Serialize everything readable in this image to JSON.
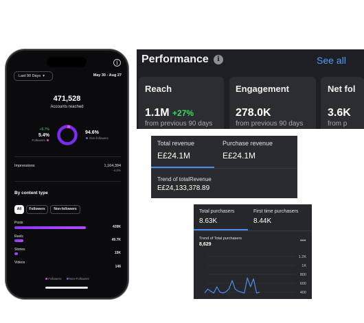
{
  "phone": {
    "info_icon": "i",
    "date_pill": "Last 90 Days",
    "date_range": "May 30 - Aug 27",
    "accounts_reached_value": "471,528",
    "accounts_reached_label": "Accounts reached",
    "followers": {
      "change": "+6.7%",
      "percent": "5.4%",
      "label": "Followers",
      "fraction": 0.054
    },
    "non_followers": {
      "percent": "94.6%",
      "label": "Non-followers",
      "fraction": 0.946
    },
    "impressions": {
      "label": "Impressions",
      "value": "1,164,394",
      "change": "-4.0%"
    },
    "content_type": {
      "title": "By content type",
      "tabs": [
        "All",
        "Followers",
        "Non-followers"
      ],
      "rows": [
        {
          "label": "Posts",
          "value": "439K",
          "fill": 0.91
        },
        {
          "label": "Reels",
          "value": "49.7K",
          "fill": 0.11
        },
        {
          "label": "Stories",
          "value": "15K",
          "fill": 0.04
        },
        {
          "label": "Videos",
          "value": "146",
          "fill": 0.0
        }
      ],
      "legend": [
        "Followers",
        "Non-Followers"
      ]
    },
    "colors": {
      "accent": "#8b35ff",
      "follower_dot": "#d34dcf",
      "non_follower_dot": "#4f6bff"
    }
  },
  "performance": {
    "title": "Performance",
    "see_all": "See all",
    "cards": [
      {
        "title": "Reach",
        "value": "1.1M",
        "change": "+27%",
        "sub": "from previous 90 days"
      },
      {
        "title": "Engagement",
        "value": "278.0K",
        "change": "",
        "sub": "from previous 90 days"
      },
      {
        "title": "Net fol",
        "value": "3.6K",
        "change": "",
        "sub": "from p"
      }
    ]
  },
  "revenue": {
    "total_label": "Total revenue",
    "total_value": "E£24.1M",
    "purchase_label": "Purchase revenue",
    "purchase_value": "E£24.1M",
    "trend_label": "Trend of totalRevenue",
    "trend_value": "E£24,133,378.89"
  },
  "purchases": {
    "total_label": "Total purchasers",
    "total_value": "8.63K",
    "first_label": "First time purchasers",
    "first_value": "8.44K",
    "trend_label": "Trend of Total purchasers",
    "trend_value": "8,629",
    "more": "•••",
    "chart_data": {
      "type": "line",
      "y_ticks": [
        "1.2K",
        "1K",
        "800",
        "600",
        "400"
      ],
      "values": [
        380,
        470,
        420,
        380,
        520,
        400,
        380,
        410,
        480,
        660,
        470,
        420,
        400,
        380,
        720,
        520,
        700,
        380,
        400
      ]
    }
  }
}
